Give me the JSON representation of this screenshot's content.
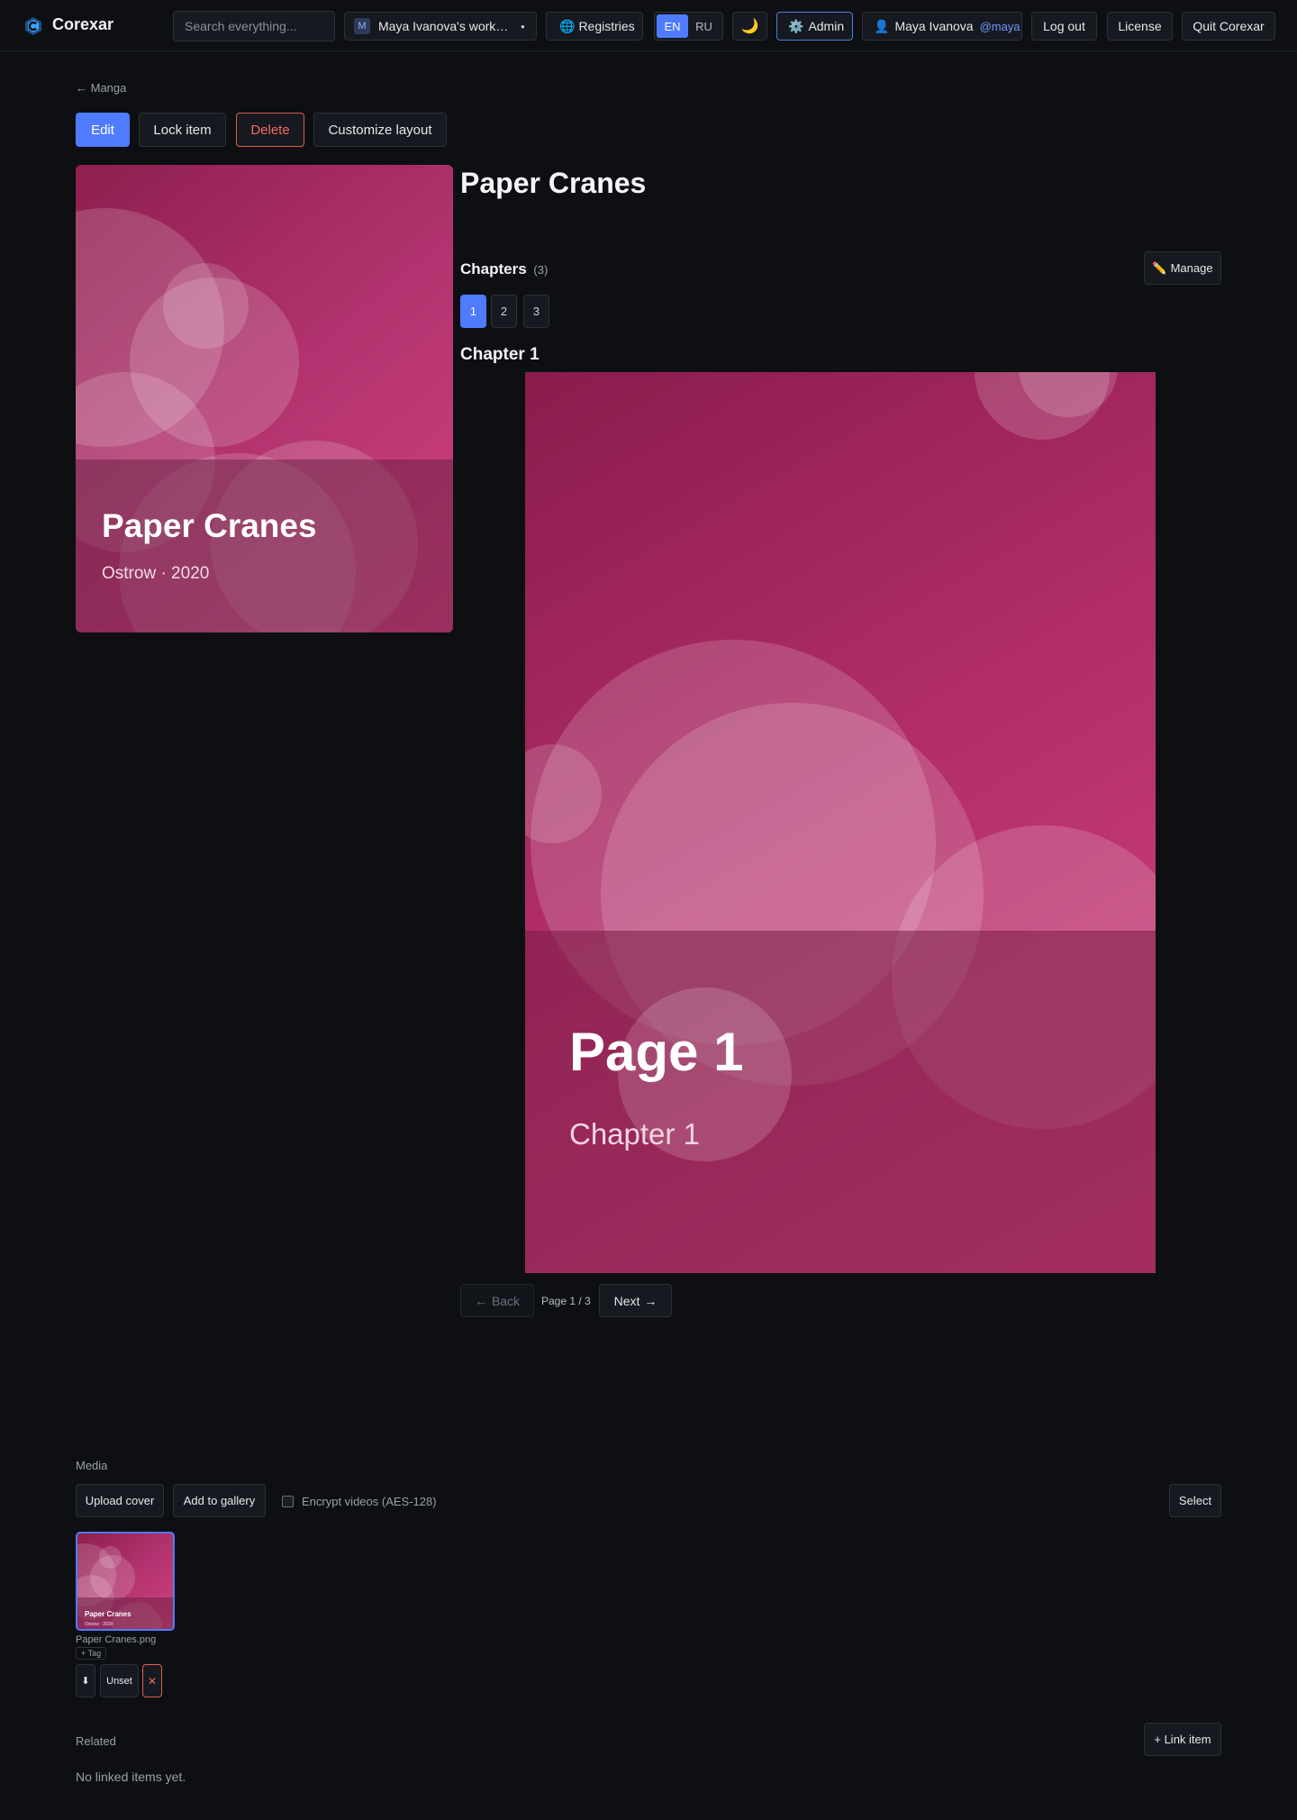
{
  "app": {
    "brand": "Corexar"
  },
  "topbar": {
    "search_placeholder": "Search everything...",
    "workspace": {
      "avatar_letter": "M",
      "label": "Maya Ivanova's workspace"
    },
    "registries_label": "Registries",
    "languages": [
      {
        "code": "EN",
        "active": true
      },
      {
        "code": "RU",
        "active": false
      }
    ],
    "theme_icon": "moon-icon",
    "admin_label": "Admin",
    "user": {
      "name": "Maya Ivanova",
      "handle": "@maya"
    },
    "logout_label": "Log out",
    "license_label": "License",
    "quit_label": "Quit Corexar"
  },
  "breadcrumb": {
    "label": "Manga"
  },
  "toolbar": {
    "edit_label": "Edit",
    "lock_label": "Lock item",
    "delete_label": "Delete",
    "layout_label": "Customize layout"
  },
  "item": {
    "title": "Paper Cranes",
    "cover": {
      "title": "Paper Cranes",
      "subtitle": "Ostrow · 2020"
    }
  },
  "chapters": {
    "heading": "Chapters",
    "count": "(3)",
    "manage_label": "Manage",
    "list": [
      {
        "label": "1",
        "active": true
      },
      {
        "label": "2",
        "active": false
      },
      {
        "label": "3",
        "active": false
      }
    ],
    "current_heading": "Chapter 1"
  },
  "reader": {
    "page_title": "Page 1",
    "page_subtitle": "Chapter 1",
    "back_label": "Back",
    "page_counter": "Page 1 / 3",
    "next_label": "Next"
  },
  "media": {
    "heading": "Media",
    "upload_label": "Upload cover",
    "gallery_label": "Add to gallery",
    "encrypt_label": "Encrypt videos (AES-128)",
    "encrypt_checked": false,
    "select_label": "Select",
    "files": [
      {
        "thumb_title": "Paper Cranes",
        "thumb_subtitle": "Ostrow · 2020",
        "filename": "Paper Cranes.png",
        "tag_label": "+ Tag",
        "unset_label": "Unset"
      }
    ]
  },
  "related": {
    "heading": "Related",
    "link_label": "+ Link item",
    "empty_text": "No linked items yet."
  },
  "colors": {
    "accent": "#4f7cff",
    "danger": "#e25c4f",
    "background": "#0d0f13",
    "surface": "#16191f"
  }
}
